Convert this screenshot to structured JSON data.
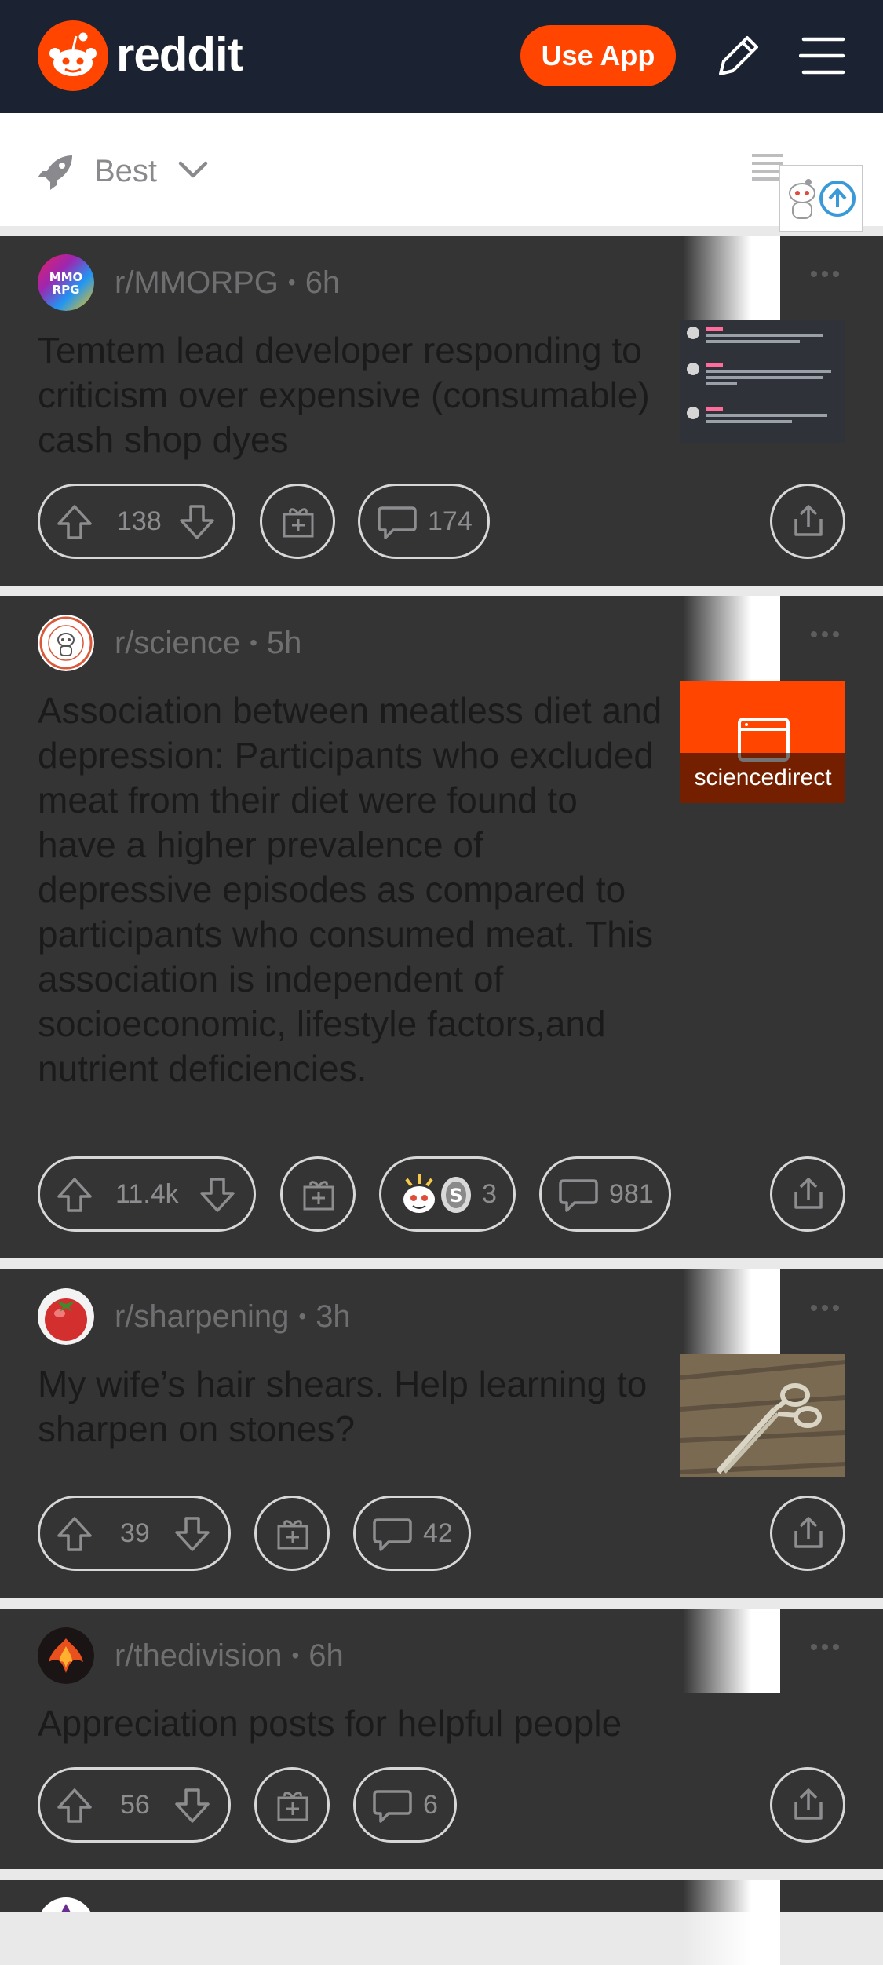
{
  "header": {
    "brand": "reddit",
    "use_app_label": "Use App",
    "icons": [
      "reddit-logo",
      "pencil-icon",
      "menu-icon"
    ]
  },
  "sort": {
    "label": "Best",
    "icons": [
      "rocket-icon",
      "chevron-down-icon",
      "card-view-icon"
    ]
  },
  "colors": {
    "brand_orange": "#ff4500",
    "header_bg": "#1b2231",
    "card_bg": "#343434"
  },
  "posts": [
    {
      "subreddit": "r/MMORPG",
      "time": "6h",
      "title": "Temtem lead developer responding to criticism over expensive (consumable) cash shop dyes",
      "votes": "138",
      "comments": "174",
      "thumbnail": "discord-screenshot"
    },
    {
      "subreddit": "r/science",
      "time": "5h",
      "title": "Association between meatless diet and depression: Participants who excluded meat from their diet were found to have a higher prevalence of depressive episodes as compared to participants who consumed meat. This association is independent of socioeconomic, lifestyle factors,and nutrient deficiencies.",
      "votes": "11.4k",
      "awards": "3",
      "comments": "981",
      "link_domain": "sciencedirect"
    },
    {
      "subreddit": "r/sharpening",
      "time": "3h",
      "title": "My wife’s hair shears. Help learning to sharpen on stones?",
      "votes": "39",
      "comments": "42",
      "thumbnail": "scissors-photo"
    },
    {
      "subreddit": "r/thedivision",
      "time": "6h",
      "title": "Appreciation posts for helpful people",
      "votes": "56",
      "comments": "6"
    }
  ]
}
